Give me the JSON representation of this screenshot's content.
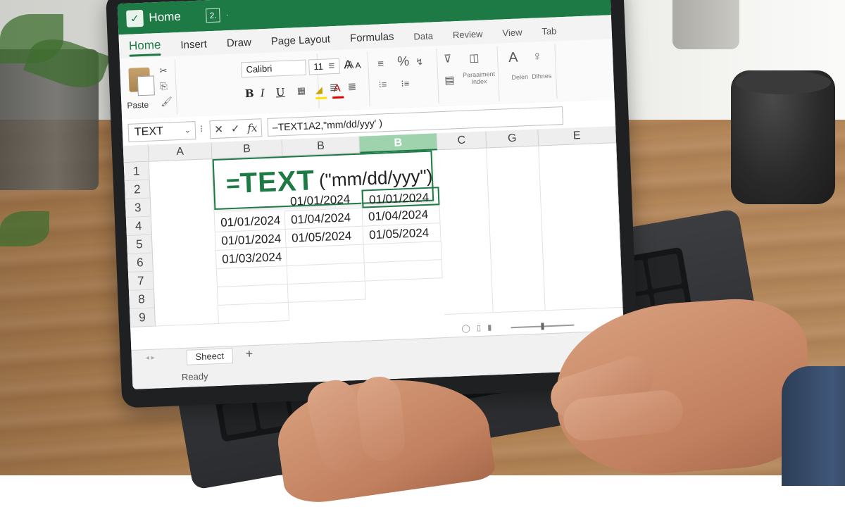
{
  "titlebar": {
    "title": "Home",
    "quick_access": "2.",
    "more": "·"
  },
  "ribbon_tabs": [
    "Home",
    "Insert",
    "Draw",
    "Page Layout",
    "Formulas",
    "Data",
    "Review",
    "View",
    "Tab"
  ],
  "ribbon": {
    "paste_label": "Paste",
    "font_name": "Calibri",
    "font_size": "11",
    "grow_font": "A",
    "shrink_font": "A",
    "bold": "B",
    "italic": "I",
    "underline": "U",
    "number_format": "%",
    "conditional_label": "Paraaiment\nIndex",
    "cells_label": "Delen",
    "editing_label": "Dlhnes"
  },
  "formula_bar": {
    "name_box": "TEXT",
    "formula": "–TEXT1A2,\"mm/dd/yyy' )"
  },
  "columns": [
    "A",
    "B",
    "B",
    "B",
    "C",
    "G",
    "E"
  ],
  "rows": [
    "1",
    "2",
    "3",
    "4",
    "5",
    "6",
    "7",
    "8",
    "9"
  ],
  "formula_banner": {
    "eq": "=",
    "fn": "TEXT",
    "args": "(\"mm/dd/yyy\")"
  },
  "grid": {
    "b_col": [
      "01/01/2024",
      "01/01/2024",
      "01/03/2024"
    ],
    "c_col": [
      "01/01/2024",
      "01/04/2024",
      "01/05/2024"
    ],
    "d_col": [
      "01/01/2024",
      "01/04/2024",
      "01/05/2024"
    ]
  },
  "sheet_tab": "Sheect",
  "add_sheet": "+",
  "status": "Ready",
  "colors": {
    "excel_green": "#1d7a45",
    "header_highlight": "#9fd3ad"
  }
}
